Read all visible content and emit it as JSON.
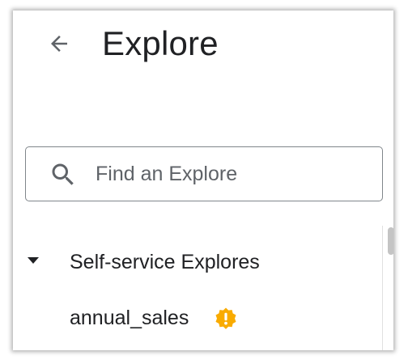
{
  "header": {
    "title": "Explore",
    "back_icon": "arrow-back-icon"
  },
  "search": {
    "placeholder": "Find an Explore",
    "value": "",
    "icon": "search-icon"
  },
  "groups": [
    {
      "label": "Self-service Explores",
      "expanded": true,
      "items": [
        {
          "label": "annual_sales",
          "badge_icon": "warning-icon",
          "badge_color": "#f9ab00"
        }
      ]
    }
  ],
  "colors": {
    "text": "#202124",
    "icon": "#5f6368",
    "border": "#80868b",
    "warning": "#f9ab00"
  }
}
